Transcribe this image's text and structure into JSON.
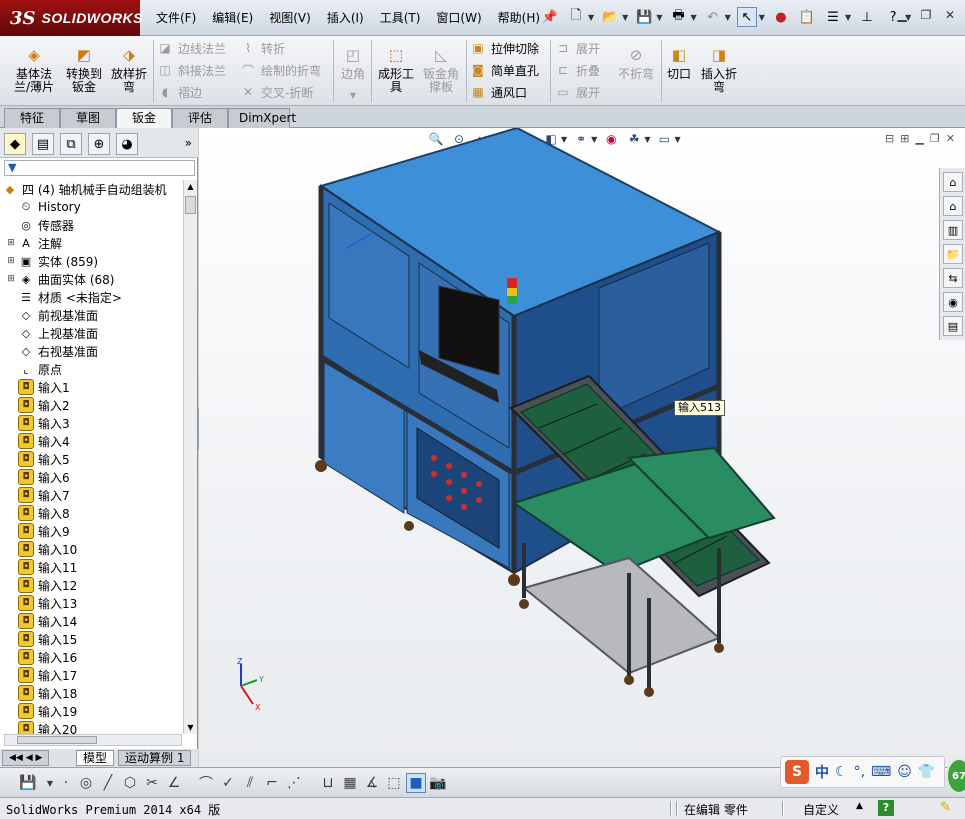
{
  "app": {
    "logo_ds": "3S",
    "logo_name": "SOLIDWORKS"
  },
  "menu": [
    "文件(F)",
    "编辑(E)",
    "视图(V)",
    "插入(I)",
    "工具(T)",
    "窗口(W)",
    "帮助(H)"
  ],
  "ribbon": {
    "base_flange": "基体法\n兰/薄片",
    "convert_to_sheet": "转换到\n钣金",
    "lofted_bend": "放样折\n弯",
    "edge_flange": "边线法兰",
    "miter_flange": "斜接法兰",
    "hem": "褶边",
    "jog": "转折",
    "sketched_bend": "绘制的折弯",
    "cross_break": "交叉-折断",
    "corners": "边角",
    "forming_tool": "成形工\n具",
    "sheet_metal_gusset": "钣金角\n撑板",
    "extruded_cut": "拉伸切除",
    "simple_hole": "简单直孔",
    "vent": "通风口",
    "unfold": "展开",
    "fold": "折叠",
    "flatten": "展开",
    "no_bends": "不折弯",
    "rip": "切口",
    "insert_bends": "插入折\n弯"
  },
  "command_tabs": [
    "特征",
    "草图",
    "钣金",
    "评估",
    "DimXpert"
  ],
  "active_command_tab": "钣金",
  "tree": {
    "root": "四 (4) 轴机械手自动组装机",
    "items": [
      {
        "label": "History",
        "icon": "history-icon",
        "expandable": false
      },
      {
        "label": "传感器",
        "icon": "sensor-icon",
        "expandable": false
      },
      {
        "label": "注解",
        "icon": "annotation-icon",
        "expandable": true
      },
      {
        "label": "实体 (859)",
        "icon": "solid-bodies-icon",
        "expandable": true
      },
      {
        "label": "曲面实体 (68)",
        "icon": "surface-bodies-icon",
        "expandable": true
      },
      {
        "label": "材质 <未指定>",
        "icon": "material-icon",
        "expandable": false
      },
      {
        "label": "前视基准面",
        "icon": "plane-icon",
        "expandable": false
      },
      {
        "label": "上视基准面",
        "icon": "plane-icon",
        "expandable": false
      },
      {
        "label": "右视基准面",
        "icon": "plane-icon",
        "expandable": false
      },
      {
        "label": "原点",
        "icon": "origin-icon",
        "expandable": false
      }
    ],
    "features": [
      "输入1",
      "输入2",
      "输入3",
      "输入4",
      "输入5",
      "输入6",
      "输入7",
      "输入8",
      "输入9",
      "输入10",
      "输入11",
      "输入12",
      "输入13",
      "输入14",
      "输入15",
      "输入16",
      "输入17",
      "输入18",
      "输入19",
      "输入20"
    ]
  },
  "bottom_tabs": [
    "模型",
    "运动算例 1"
  ],
  "tooltip": "输入513",
  "triad": {
    "x": "X",
    "y": "Y",
    "z": "Z"
  },
  "status": {
    "product": "SolidWorks Premium 2014 x64 版",
    "edit_mode": "在编辑 零件",
    "units": "自定义",
    "help": "?"
  },
  "ime": {
    "logo": "S",
    "mode": "中"
  },
  "badge": "67",
  "colors": {
    "panel_blue": "#2f6fb3",
    "top_blue": "#3b8fd6",
    "frame_dark": "#2a2e36",
    "conveyor_green": "#1f7a5a",
    "brand_red": "#a01010"
  }
}
